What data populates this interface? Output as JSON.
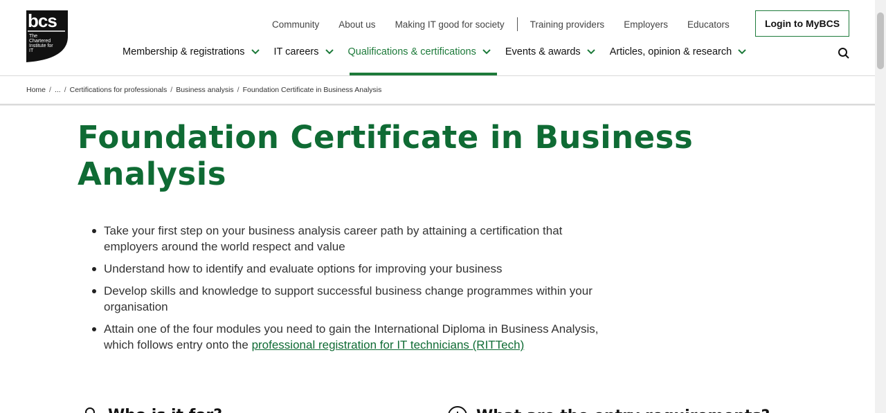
{
  "logo": {
    "wordmark": "bcs",
    "tagline": "The Chartered Institute for IT"
  },
  "utility_nav": {
    "group1": [
      "Community",
      "About us",
      "Making IT good for society"
    ],
    "group2": [
      "Training providers",
      "Employers",
      "Educators"
    ]
  },
  "login_button": "Login to MyBCS",
  "main_nav": [
    {
      "label": "Membership & registrations"
    },
    {
      "label": "IT careers"
    },
    {
      "label": "Qualifications & certifications",
      "active": true
    },
    {
      "label": "Events & awards"
    },
    {
      "label": "Articles, opinion & research"
    }
  ],
  "breadcrumb": [
    "Home",
    "...",
    "Certifications for professionals",
    "Business analysis",
    "Foundation Certificate in Business Analysis"
  ],
  "page_title": "Foundation Certificate in Business Analysis",
  "bullets": {
    "b1": "Take your first step on your business analysis career path by attaining a certification that employers around the world respect and value",
    "b2": "Understand how to identify and evaluate options for improving your business",
    "b3": "Develop skills and knowledge to support successful business change programmes within your organisation",
    "b4_text": "Attain one of the four modules you need to gain the International Diploma in Business Analysis, which follows entry onto the ",
    "b4_link": "professional registration for IT technicians (RITTech)"
  },
  "sections": {
    "who": "Who is it for?",
    "what": "What are the entry requirements?"
  },
  "colors": {
    "brand_green": "#0f6b34",
    "accent_green": "#1d7a3a"
  },
  "icons": [
    "search-icon",
    "chevron-down-icon",
    "person-icon",
    "info-icon"
  ]
}
